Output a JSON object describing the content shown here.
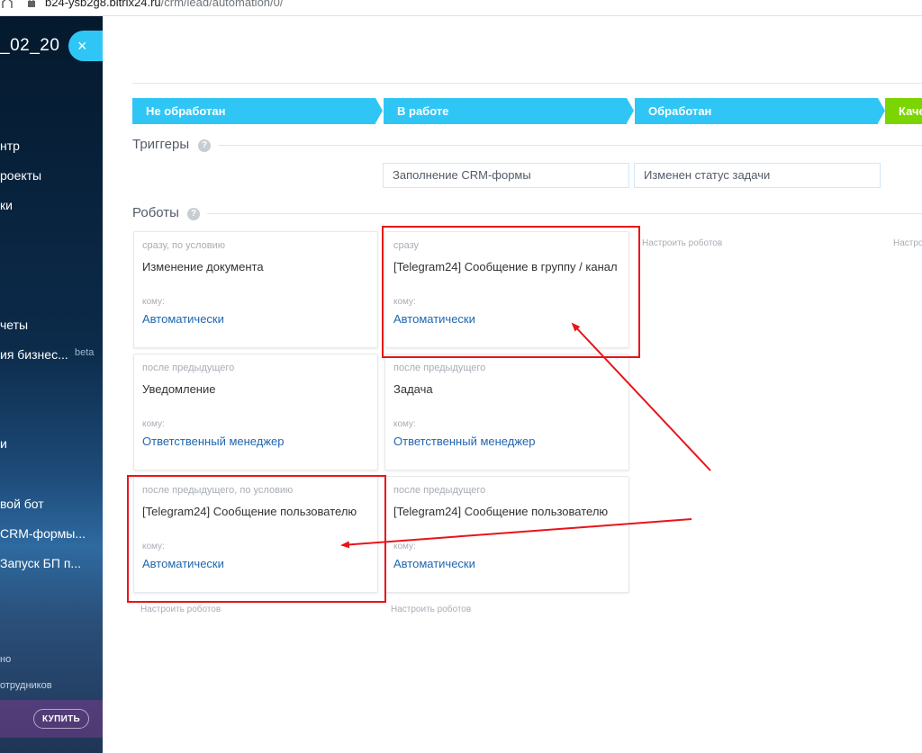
{
  "browser": {
    "url_host": "b24-ysb2g8.bitrix24.ru",
    "url_path": "/crm/lead/automation/0/"
  },
  "sidebar": {
    "portal_title_prefix": "",
    "portal_title": "_02_20",
    "items": [
      {
        "label": "нтр"
      },
      {
        "label": "роекты"
      },
      {
        "label": "ки"
      },
      {
        "label": "четы"
      },
      {
        "label": "ия бизнес..."
      },
      {
        "label": "и"
      },
      {
        "label": "вой бот"
      },
      {
        "label": "CRM-формы..."
      },
      {
        "label": "Запуск БП п..."
      }
    ],
    "beta_label": "beta",
    "bottom_items": [
      {
        "label": "но"
      },
      {
        "label": "отрудников"
      }
    ],
    "buy_label": "КУПИТЬ",
    "close_label": "×"
  },
  "stages": [
    {
      "label": "Не обработан"
    },
    {
      "label": "В работе"
    },
    {
      "label": "Обработан"
    },
    {
      "label": "Каче"
    }
  ],
  "triggers": {
    "title": "Триггеры",
    "items": [
      {
        "label": "Заполнение CRM-формы"
      },
      {
        "label": "Изменен статус задачи"
      }
    ]
  },
  "robots": {
    "title": "Роботы",
    "to_label": "кому:",
    "columns": [
      [
        {
          "condition": "сразу, по условию",
          "title": "Изменение документа",
          "responsible": "Автоматически"
        },
        {
          "condition": "после предыдущего",
          "title": "Уведомление",
          "responsible": "Ответственный менеджер"
        },
        {
          "condition": "после предыдущего, по условию",
          "title": "[Telegram24] Сообщение пользователю",
          "responsible": "Автоматически"
        }
      ],
      [
        {
          "condition": "сразу",
          "title": "[Telegram24] Сообщение в группу / канал",
          "responsible": "Автоматически"
        },
        {
          "condition": "после предыдущего",
          "title": "Задача",
          "responsible": "Ответственный менеджер"
        },
        {
          "condition": "после предыдущего",
          "title": "[Telegram24] Сообщение пользователю",
          "responsible": "Автоматически"
        }
      ]
    ],
    "config_label": "Настроить роботов",
    "config_label_cut": "Настро"
  },
  "help_label": "?",
  "colors": {
    "stage_blue": "#2fc6f6",
    "stage_green": "#7bd500",
    "annotation_red": "#e8141a",
    "link_blue": "#2067b0"
  }
}
